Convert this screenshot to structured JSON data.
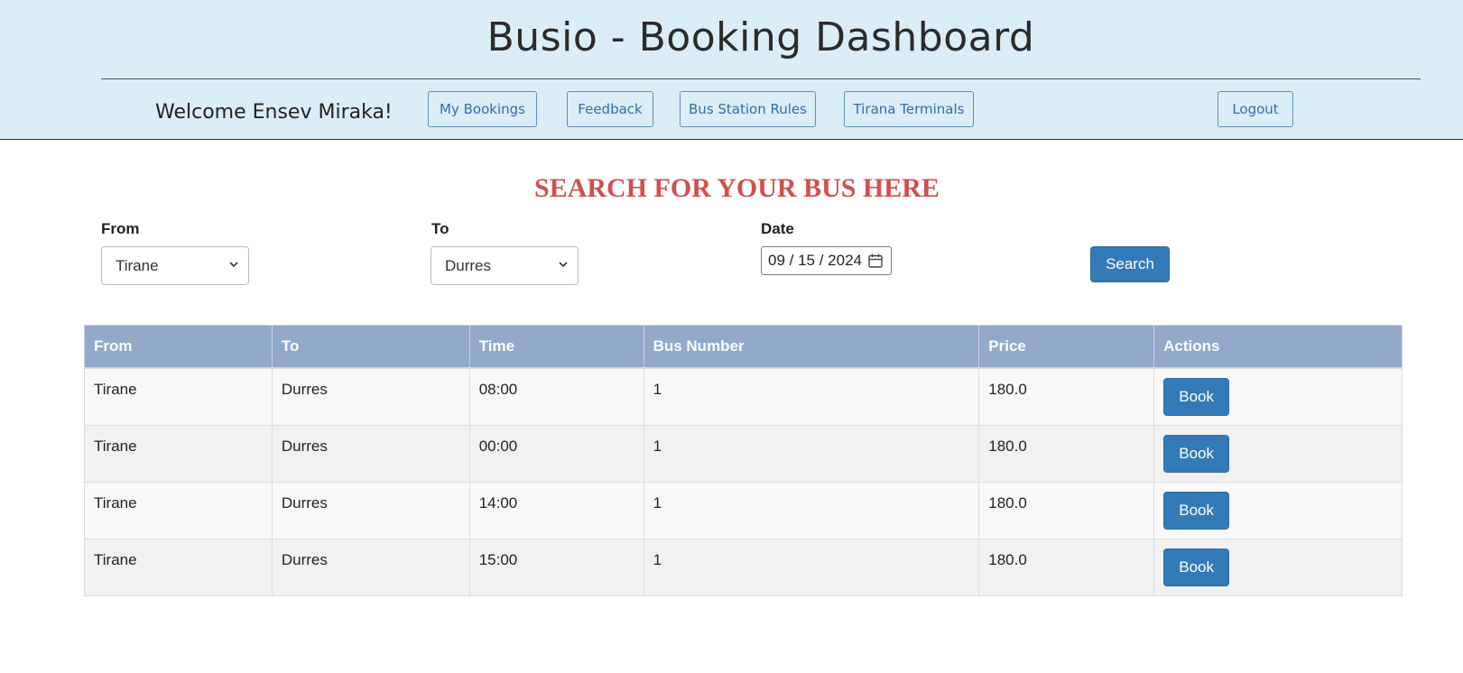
{
  "header": {
    "title": "Busio - Booking Dashboard",
    "welcome": "Welcome Ensev Miraka!",
    "nav": {
      "my_bookings": "My Bookings",
      "feedback": "Feedback",
      "bus_station_rules": "Bus Station Rules",
      "tirana_terminals": "Tirana Terminals",
      "logout": "Logout"
    }
  },
  "search": {
    "heading": "SEARCH FOR YOUR BUS HERE",
    "from_label": "From",
    "from_value": "Tirane",
    "to_label": "To",
    "to_value": "Durres",
    "date_label": "Date",
    "date_value": "09 / 15 / 2024",
    "search_button": "Search"
  },
  "table": {
    "headers": [
      "From",
      "To",
      "Time",
      "Bus Number",
      "Price",
      "Actions"
    ],
    "rows": [
      {
        "from": "Tirane",
        "to": "Durres",
        "time": "08:00",
        "bus_number": "1",
        "price": "180.0",
        "action": "Book"
      },
      {
        "from": "Tirane",
        "to": "Durres",
        "time": "00:00",
        "bus_number": "1",
        "price": "180.0",
        "action": "Book"
      },
      {
        "from": "Tirane",
        "to": "Durres",
        "time": "14:00",
        "bus_number": "1",
        "price": "180.0",
        "action": "Book"
      },
      {
        "from": "Tirane",
        "to": "Durres",
        "time": "15:00",
        "bus_number": "1",
        "price": "180.0",
        "action": "Book"
      }
    ]
  },
  "icons": {
    "select_chevron": "chevron-down-icon",
    "date_picker": "calendar-icon"
  },
  "colors": {
    "header_bg": "#dbedf7",
    "heading_red": "#d0504f",
    "primary_button": "#337ab7",
    "table_header": "#93a9ca"
  }
}
